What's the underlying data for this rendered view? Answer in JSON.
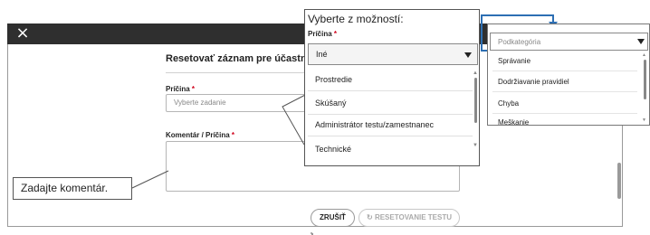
{
  "dialog": {
    "title": "Resetovať záznam pre účastníka te",
    "close_glyph": "×",
    "reason_label": "Príčina",
    "required_mark": "*",
    "reason_placeholder": "Vyberte zadanie",
    "comment_label": "Komentár / Príčina",
    "cancel_label": "ZRUŠIŤ",
    "reset_label": "RESETOVANIE TESTU",
    "reset_icon": "refresh-icon"
  },
  "callout": {
    "text": "Zadajte komentár."
  },
  "popup_reason": {
    "title": "Vyberte z možností:",
    "label": "Príčina",
    "required_mark": "*",
    "selected": "Iné",
    "options": [
      "Prostredie",
      "Skúšaný",
      "Administrátor testu/zamestnanec",
      "Technické"
    ]
  },
  "popup_subcategory": {
    "placeholder": "Podkategória",
    "options": [
      "Správanie",
      "Dodržiavanie pravidiel",
      "Chyba",
      "Meškanie"
    ]
  },
  "colors": {
    "titlebar": "#2f2f2f",
    "arrow": "#2d6fb3",
    "required": "#d0021b"
  }
}
